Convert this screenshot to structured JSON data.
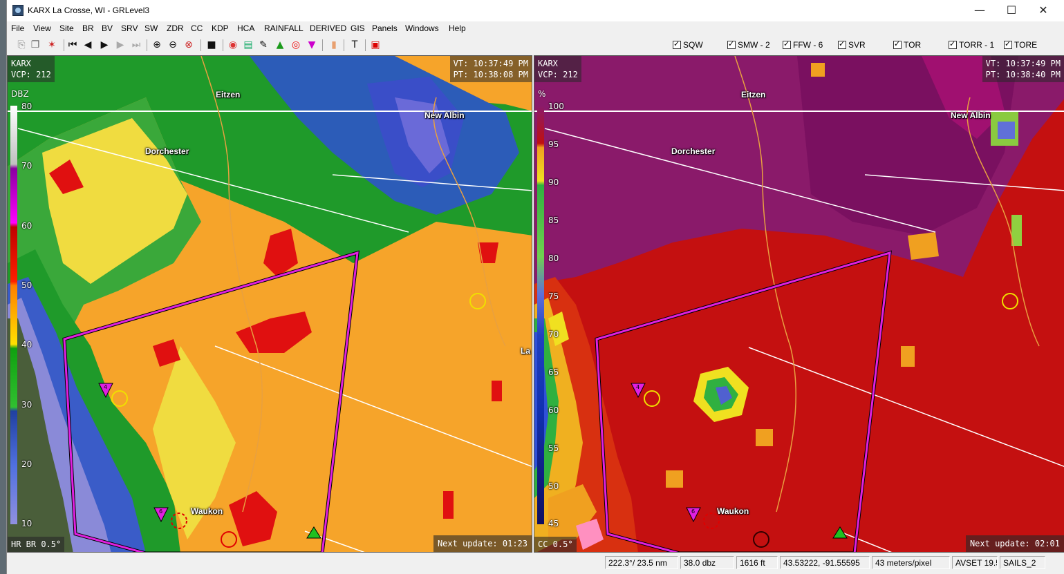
{
  "window": {
    "title": "KARX La Crosse, WI - GRLevel3",
    "controls": {
      "minimize": "—",
      "maximize": "☐",
      "close": "✕"
    }
  },
  "menu": [
    "File",
    "View",
    "Site",
    "BR",
    "BV",
    "SRV",
    "SW",
    "ZDR",
    "CC",
    "KDP",
    "HCA",
    "RAINFALL",
    "DERIVED",
    "GIS",
    "Panels",
    "Windows",
    "Help"
  ],
  "warning_toggles": [
    {
      "label": "SQW",
      "checked": true
    },
    {
      "label": "SMW - 2",
      "checked": true
    },
    {
      "label": "FFW - 6",
      "checked": true
    },
    {
      "label": "SVR",
      "checked": true
    },
    {
      "label": "TOR",
      "checked": true
    },
    {
      "label": "TORR - 1",
      "checked": true
    },
    {
      "label": "TORE",
      "checked": true
    }
  ],
  "left_panel": {
    "site_info": "KARX\nVCP: 212",
    "time_info": "VT: 10:37:49 PM\nPT: 10:38:08 PM",
    "legend_unit": "DBZ",
    "legend_ticks": [
      "80",
      "70",
      "60",
      "50",
      "40",
      "30",
      "20",
      "10"
    ],
    "product": "HR BR 0.5°",
    "next_update": "Next update: 01:23"
  },
  "right_panel": {
    "site_info": "KARX\nVCP: 212",
    "time_info": "VT: 10:37:49 PM\nPT: 10:38:40 PM",
    "legend_unit": "%",
    "legend_ticks": [
      "100",
      "95",
      "90",
      "85",
      "80",
      "75",
      "70",
      "65",
      "60",
      "55",
      "50",
      "45"
    ],
    "product": "CC 0.5°",
    "next_update": "Next update: 02:01"
  },
  "cities": [
    "Eitzen",
    "Dorchester",
    "New Albin",
    "Waukon",
    "La"
  ],
  "storm_markers": {
    "hail_left": "4",
    "hail_bottom": "6"
  },
  "status": {
    "azimuth_range": "222.3°/ 23.5 nm",
    "value": "38.0 dbz",
    "height": "1616 ft",
    "latlon": "43.53222, -91.55595",
    "resolution": "43 meters/pixel",
    "avset": "AVSET 19.5°",
    "sails": "SAILS_2"
  },
  "colors": {
    "warning_polygon": "#e020e0",
    "ref_orange": "#f5a020",
    "cc_red": "#c41010",
    "cc_purple": "#8a1a6a"
  }
}
